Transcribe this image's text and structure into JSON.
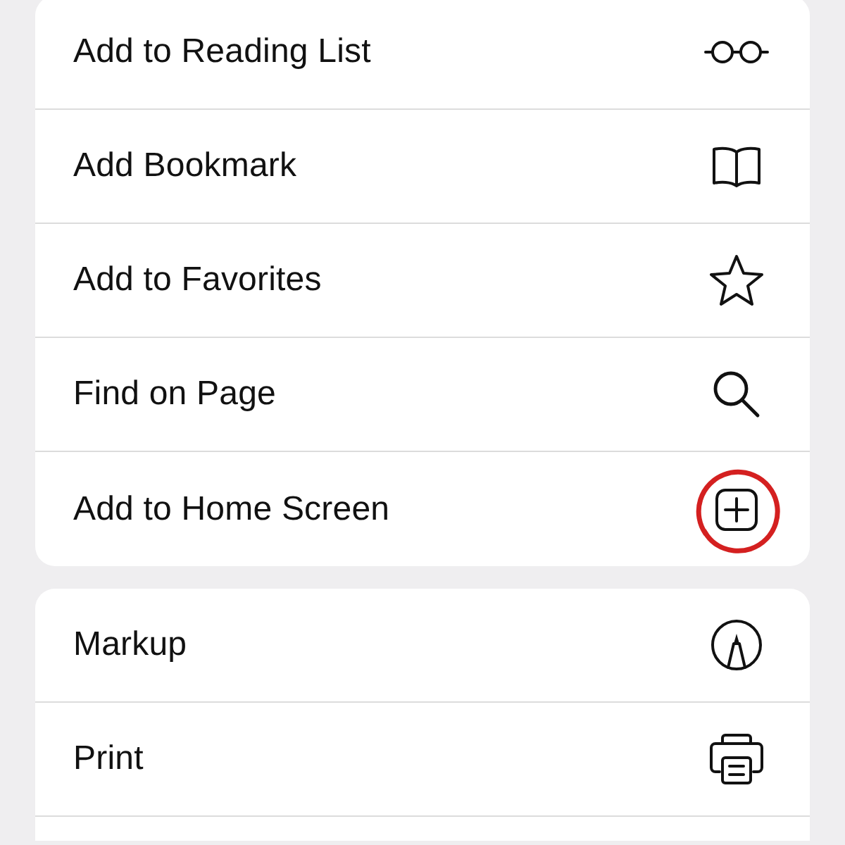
{
  "groups": [
    {
      "items": [
        {
          "label": "Add to Reading List",
          "kind": "glasses",
          "highlighted": false
        },
        {
          "label": "Add Bookmark",
          "kind": "book",
          "highlighted": false
        },
        {
          "label": "Add to Favorites",
          "kind": "star",
          "highlighted": false
        },
        {
          "label": "Find on Page",
          "kind": "search",
          "highlighted": false
        },
        {
          "label": "Add to Home Screen",
          "kind": "plus-square",
          "highlighted": true
        }
      ]
    },
    {
      "items": [
        {
          "label": "Markup",
          "kind": "markup",
          "highlighted": false
        },
        {
          "label": "Print",
          "kind": "printer",
          "highlighted": false
        },
        {
          "kind": "blank"
        }
      ]
    }
  ]
}
